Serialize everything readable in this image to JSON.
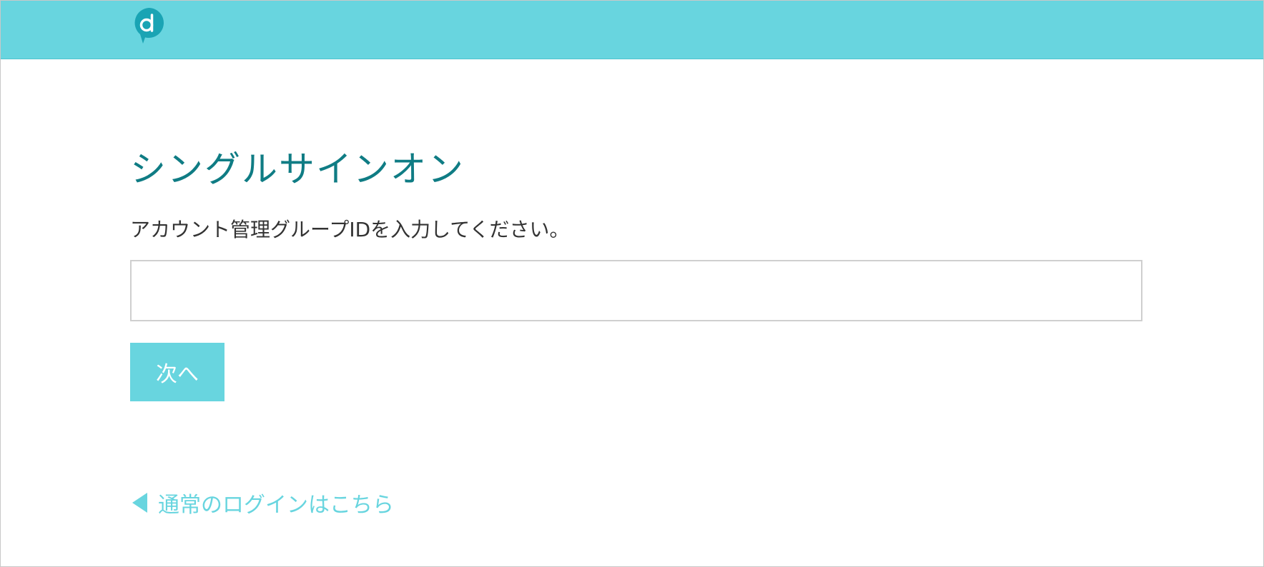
{
  "header": {
    "logo_icon": "d-chat-bubble-logo-icon",
    "background_color": "#68d5df"
  },
  "main": {
    "title": "シングルサインオン",
    "instruction": "アカウント管理グループIDを入力してください。",
    "group_id_input": {
      "value": "",
      "placeholder": ""
    },
    "next_button_label": "次へ",
    "back_link": {
      "icon": "triangle-left-icon",
      "label": "通常のログインはこちら"
    }
  },
  "colors": {
    "accent": "#68d5df",
    "title": "#0f7c84",
    "text": "#333333"
  }
}
